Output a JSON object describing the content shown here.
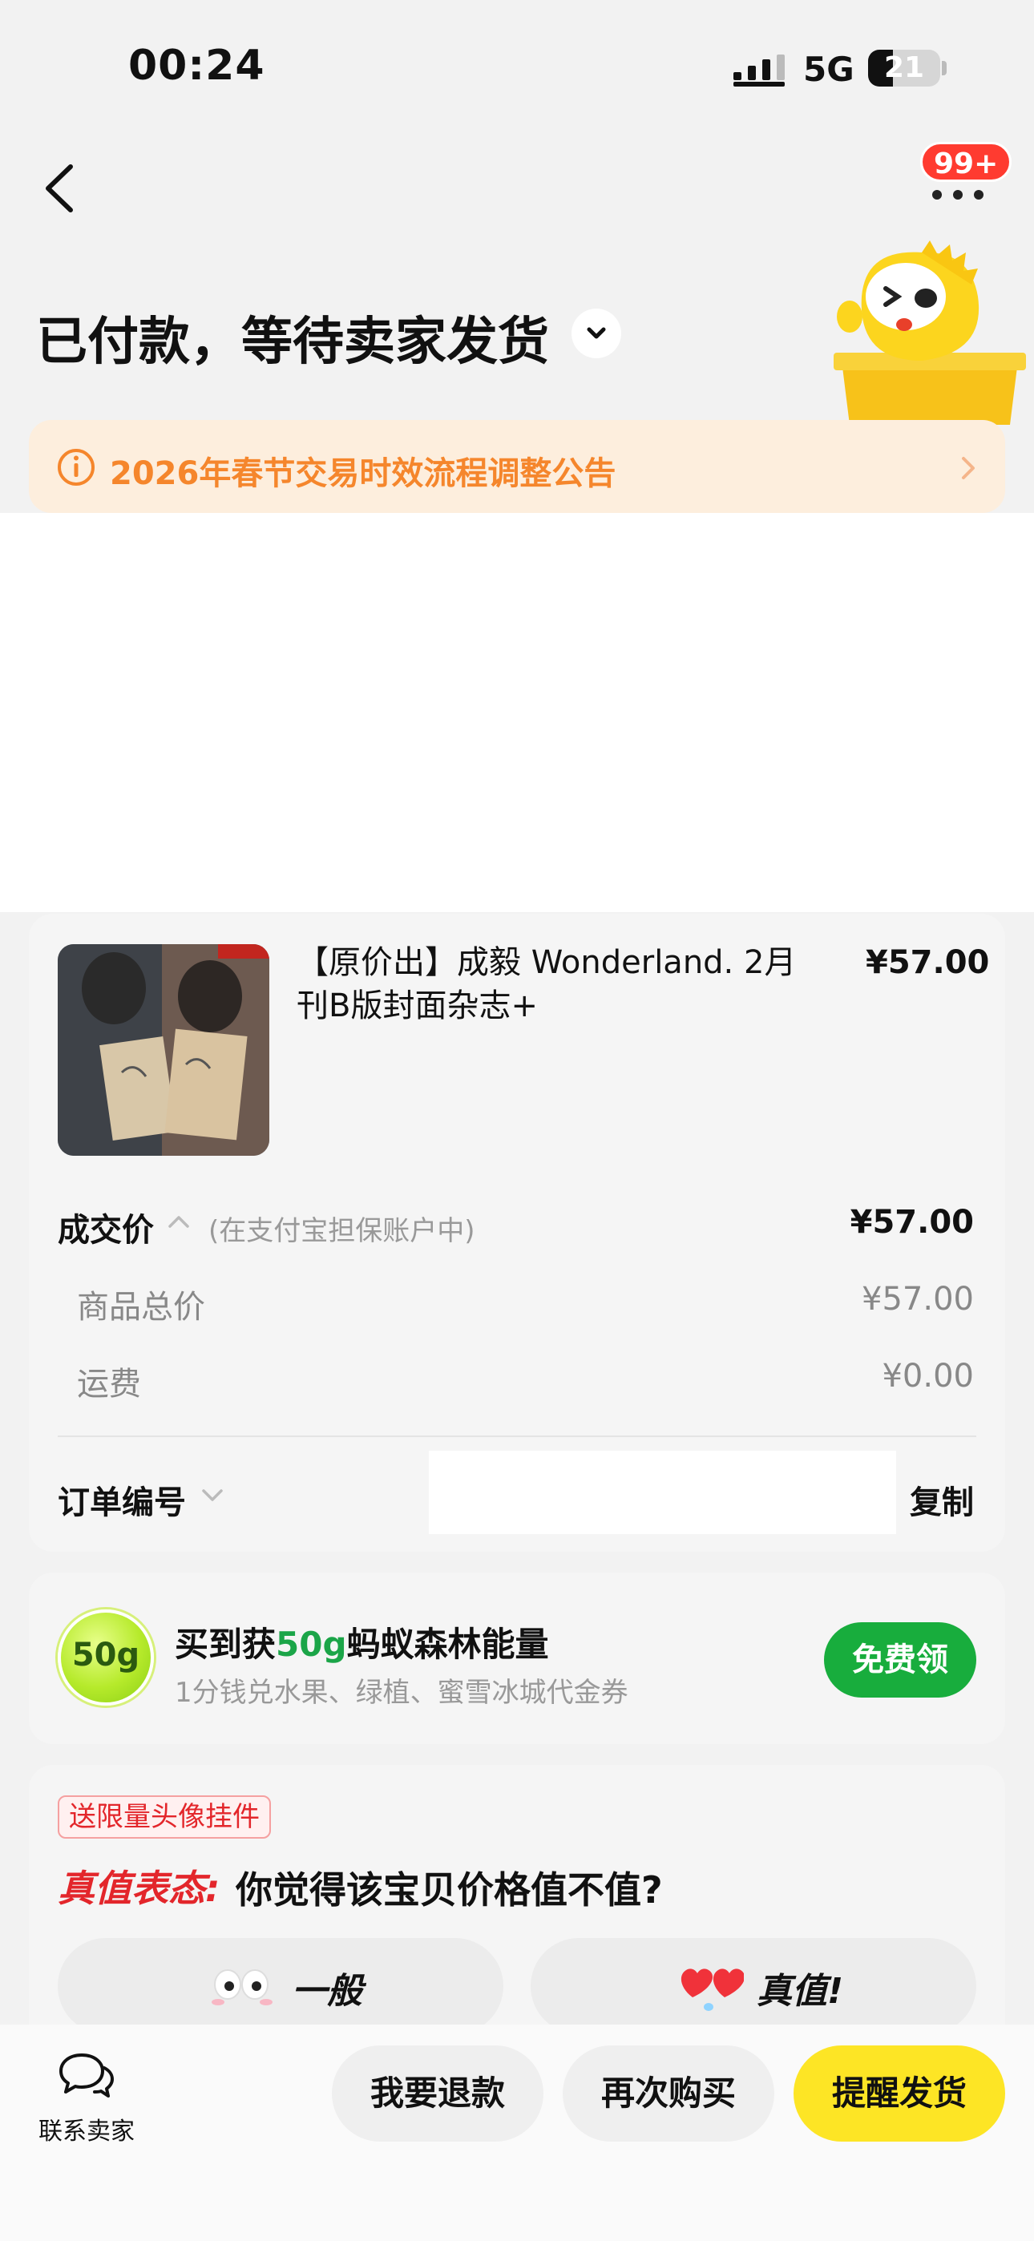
{
  "status_bar": {
    "time": "00:24",
    "network": "5G",
    "battery": "21"
  },
  "header": {
    "badge": "99+",
    "title": "已付款，等待卖家发货",
    "notice": "2026年春节交易时效流程调整公告"
  },
  "order": {
    "product_name": "【原价出】成毅 Wonderland. 2月刊B版封面杂志+",
    "product_price": "¥57.00",
    "deal_label": "成交价",
    "deal_note": "(在支付宝担保账户中)",
    "deal_price": "¥57.00",
    "subtotal_label": "商品总价",
    "subtotal_value": "¥57.00",
    "shipping_label": "运费",
    "shipping_value": "¥0.00",
    "order_no_label": "订单编号",
    "copy_label": "复制"
  },
  "energy": {
    "badge": "50g",
    "title_prefix": "买到获",
    "title_highlight": "50g",
    "title_suffix": "蚂蚁森林能量",
    "subtitle": "1分钱兑水果、绿植、蜜雪冰城代金券",
    "button": "免费领"
  },
  "rating": {
    "tag": "送限量头像挂件",
    "question_label": "真值表态:",
    "question": "你觉得该宝贝价格值不值?",
    "option1": "一般",
    "option2": "真值!"
  },
  "bottom_bar": {
    "contact": "联系卖家",
    "refund": "我要退款",
    "rebuy": "再次购买",
    "remind": "提醒发货"
  },
  "colors": {
    "accent_yellow": "#fde525",
    "green": "#18ad3d",
    "red": "#e3262b",
    "orange": "#f5862c"
  }
}
